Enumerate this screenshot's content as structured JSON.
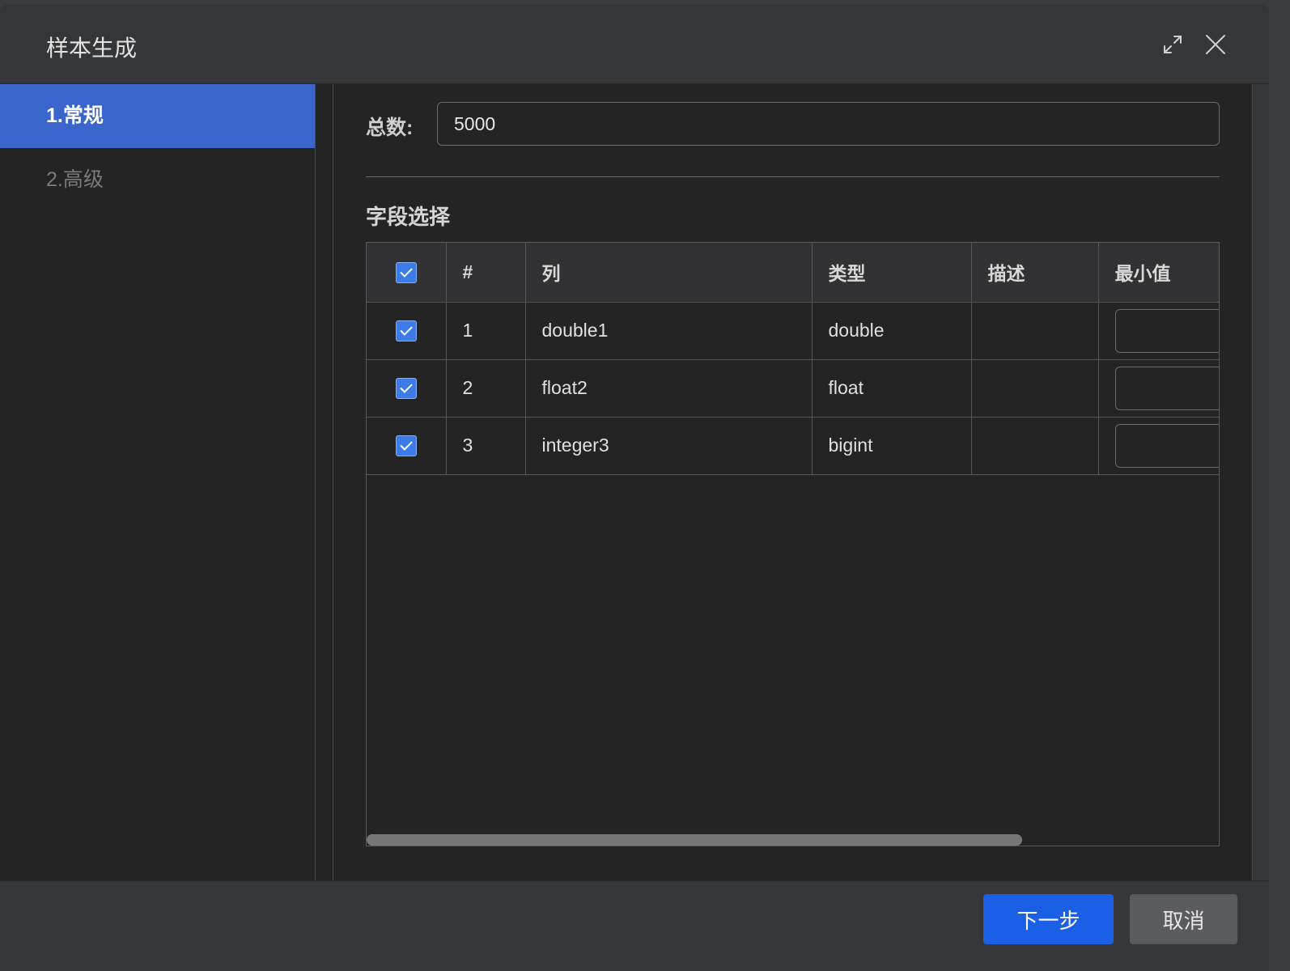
{
  "dialog": {
    "title": "样本生成",
    "maximize_icon": "expand-arrows-icon",
    "close_icon": "close-x-icon"
  },
  "steps": [
    {
      "label": "1.常规",
      "active": true
    },
    {
      "label": "2.高级",
      "active": false
    }
  ],
  "form": {
    "total_label": "总数:",
    "total_value": "5000"
  },
  "fields": {
    "section_title": "字段选择",
    "columns": [
      "#",
      "列",
      "类型",
      "描述",
      "最小值"
    ],
    "rows": [
      {
        "index": "1",
        "column": "double1",
        "type": "double",
        "description": "",
        "min": "",
        "checked": true
      },
      {
        "index": "2",
        "column": "float2",
        "type": "float",
        "description": "",
        "min": "",
        "checked": true
      },
      {
        "index": "3",
        "column": "integer3",
        "type": "bigint",
        "description": "",
        "min": "",
        "checked": true
      }
    ],
    "select_all_checked": true
  },
  "footer": {
    "next_label": "下一步",
    "cancel_label": "取消"
  },
  "colors": {
    "accent": "#3a66cc",
    "primary_button": "#1a5fe6",
    "checkbox": "#3d7be8"
  }
}
